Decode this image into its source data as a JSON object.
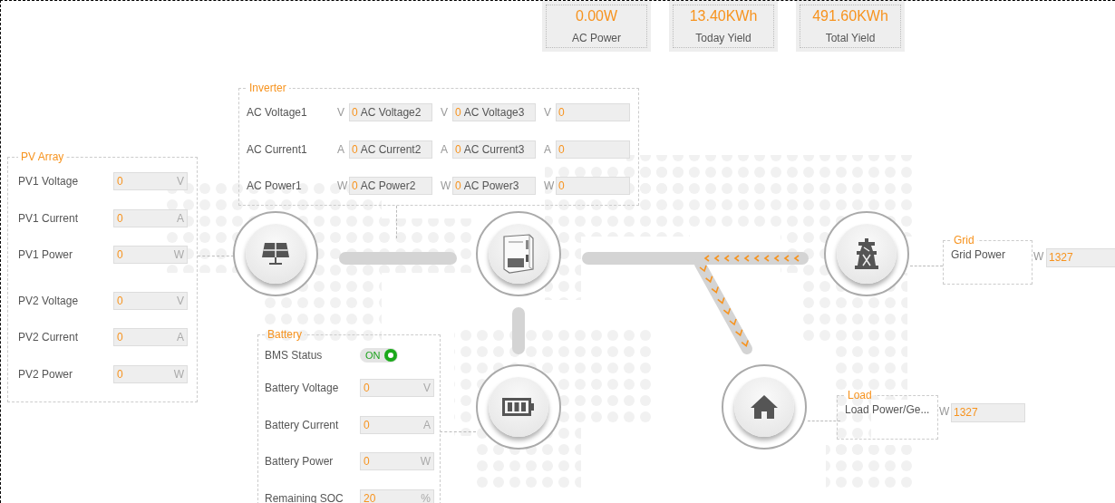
{
  "summary": [
    {
      "value": "0.00W",
      "label": "AC Power"
    },
    {
      "value": "13.40KWh",
      "label": "Today Yield"
    },
    {
      "value": "491.60KWh",
      "label": "Total Yield"
    }
  ],
  "pv_array": {
    "title": "PV Array",
    "groups": [
      [
        {
          "label": "PV1 Voltage",
          "value": "0",
          "unit": "V"
        },
        {
          "label": "PV1 Current",
          "value": "0",
          "unit": "A"
        },
        {
          "label": "PV1 Power",
          "value": "0",
          "unit": "W"
        }
      ],
      [
        {
          "label": "PV2 Voltage",
          "value": "0",
          "unit": "V"
        },
        {
          "label": "PV2 Current",
          "value": "0",
          "unit": "A"
        },
        {
          "label": "PV2 Power",
          "value": "0",
          "unit": "W"
        }
      ]
    ]
  },
  "inverter": {
    "title": "Inverter",
    "rows": [
      [
        {
          "label": "AC Voltage1",
          "unit": "V",
          "value": "0"
        },
        {
          "label": "AC Voltage2",
          "unit": "V",
          "value": "0"
        },
        {
          "label": "AC Voltage3",
          "unit": "V",
          "value": "0"
        }
      ],
      [
        {
          "label": "AC Current1",
          "unit": "A",
          "value": "0"
        },
        {
          "label": "AC Current2",
          "unit": "A",
          "value": "0"
        },
        {
          "label": "AC Current3",
          "unit": "A",
          "value": "0"
        }
      ],
      [
        {
          "label": "AC Power1",
          "unit": "W",
          "value": "0"
        },
        {
          "label": "AC Power2",
          "unit": "W",
          "value": "0"
        },
        {
          "label": "AC Power3",
          "unit": "W",
          "value": "0"
        }
      ]
    ]
  },
  "battery": {
    "title": "Battery",
    "bms": {
      "label": "BMS Status",
      "on": true,
      "text": "ON"
    },
    "rows": [
      {
        "label": "Battery Voltage",
        "value": "0",
        "unit": "V"
      },
      {
        "label": "Battery Current",
        "value": "0",
        "unit": "A"
      },
      {
        "label": "Battery Power",
        "value": "0",
        "unit": "W"
      },
      {
        "label": "Remaining SOC",
        "value": "20",
        "unit": "%"
      }
    ]
  },
  "grid": {
    "title": "Grid",
    "label": "Grid Power",
    "unit": "W",
    "value": "1327"
  },
  "load": {
    "title": "Load",
    "label": "Load Power/Ge...",
    "unit": "W",
    "value": "1327"
  },
  "flows": {
    "pv_inverter": {
      "active": false
    },
    "inverter_grid": {
      "active": true
    },
    "inverter_battery": {
      "active": false
    },
    "inverter_load": {
      "active": true
    }
  }
}
